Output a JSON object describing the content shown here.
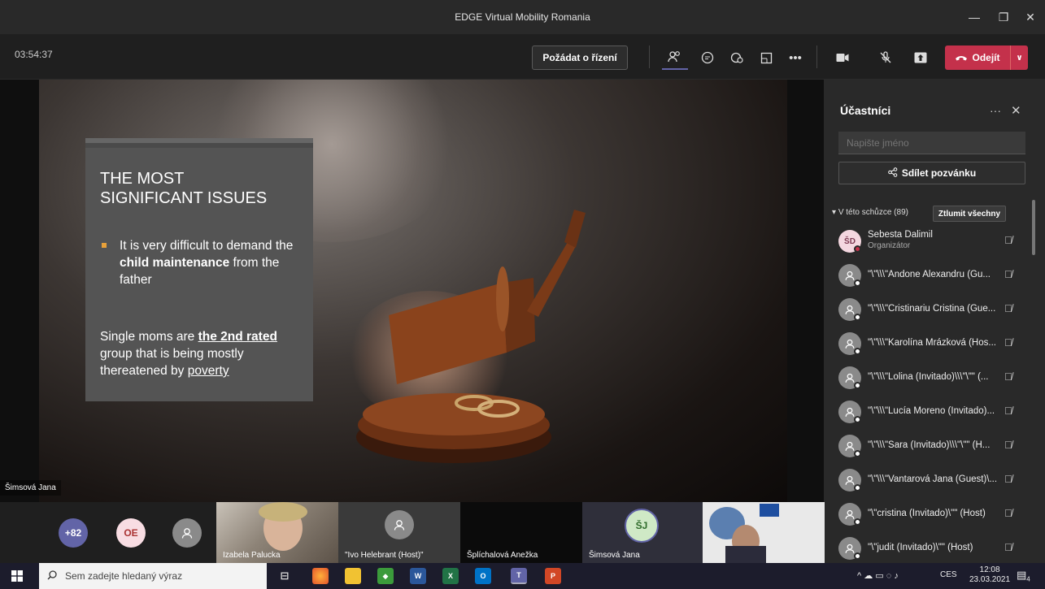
{
  "window": {
    "title": "EDGE Virtual Mobility Romania"
  },
  "toolbar": {
    "timer": "03:54:37",
    "request_control": "Požádat o řízení",
    "leave": "Odejít"
  },
  "slide": {
    "title_line1": "THE MOST",
    "title_line2": "SIGNIFICANT ISSUES",
    "bullet_pre": "It is very difficult to demand the",
    "bullet_bold": "child maintenance",
    "bullet_post": "from the father",
    "para_pre": "Single moms are",
    "para_bold": "the 2nd rated",
    "para_mid": "group that is being mostly thereatened by",
    "para_link": "poverty"
  },
  "stage": {
    "speaker_name": "Šimsová Jana"
  },
  "panel": {
    "title": "Účastníci",
    "search_placeholder": "Napište jméno",
    "share_invite": "Sdílet pozvánku",
    "in_meeting": "V této schůzce (89)",
    "mute_all": "Ztlumit všechny",
    "participants": [
      {
        "initials": "ŠD",
        "name": "Šebesta Dalimil",
        "role": "Organizátor"
      },
      {
        "name": "\"\\\"\\\\\\\"Andone Alexandru (Gu..."
      },
      {
        "name": "\"\\\"\\\\\\\"Cristinariu Cristina (Gue..."
      },
      {
        "name": "\"\\\"\\\\\\\"Karolína Mrázková (Hos..."
      },
      {
        "name": "\"\\\"\\\\\\\"Lolina (Invitado)\\\\\\\"\\\"\" (..."
      },
      {
        "name": "\"\\\"\\\\\\\"Lucía Moreno (Invitado)..."
      },
      {
        "name": "\"\\\"\\\\\\\"Sara (Invitado)\\\\\\\"\\\"\" (H..."
      },
      {
        "name": "\"\\\"\\\\\\\"Vantarová Jana (Guest)\\..."
      },
      {
        "name": "\"\\\"cristina (Invitado)\\\"\" (Host)"
      },
      {
        "name": "\"\\\"judit (Invitado)\\\"\" (Host)"
      }
    ]
  },
  "strip": {
    "overflow_count": "+82",
    "oe_initials": "OE",
    "tile_izabela": "Izabela Palucka",
    "tile_ivo": "\"Ivo Helebrant (Host)\"",
    "tile_splichalova": "Šplíchalová Anežka",
    "tile_simsova": "Šimsová Jana",
    "simsova_initials": "ŠJ"
  },
  "taskbar": {
    "search_placeholder": "Sem zadejte hledaný výraz",
    "lang": "CES",
    "time": "12:08",
    "date": "23.03.2021",
    "notif_count": "4"
  },
  "colors": {
    "leave": "#c4314b",
    "accent": "#6264a7",
    "bullet": "#e8a13a"
  }
}
